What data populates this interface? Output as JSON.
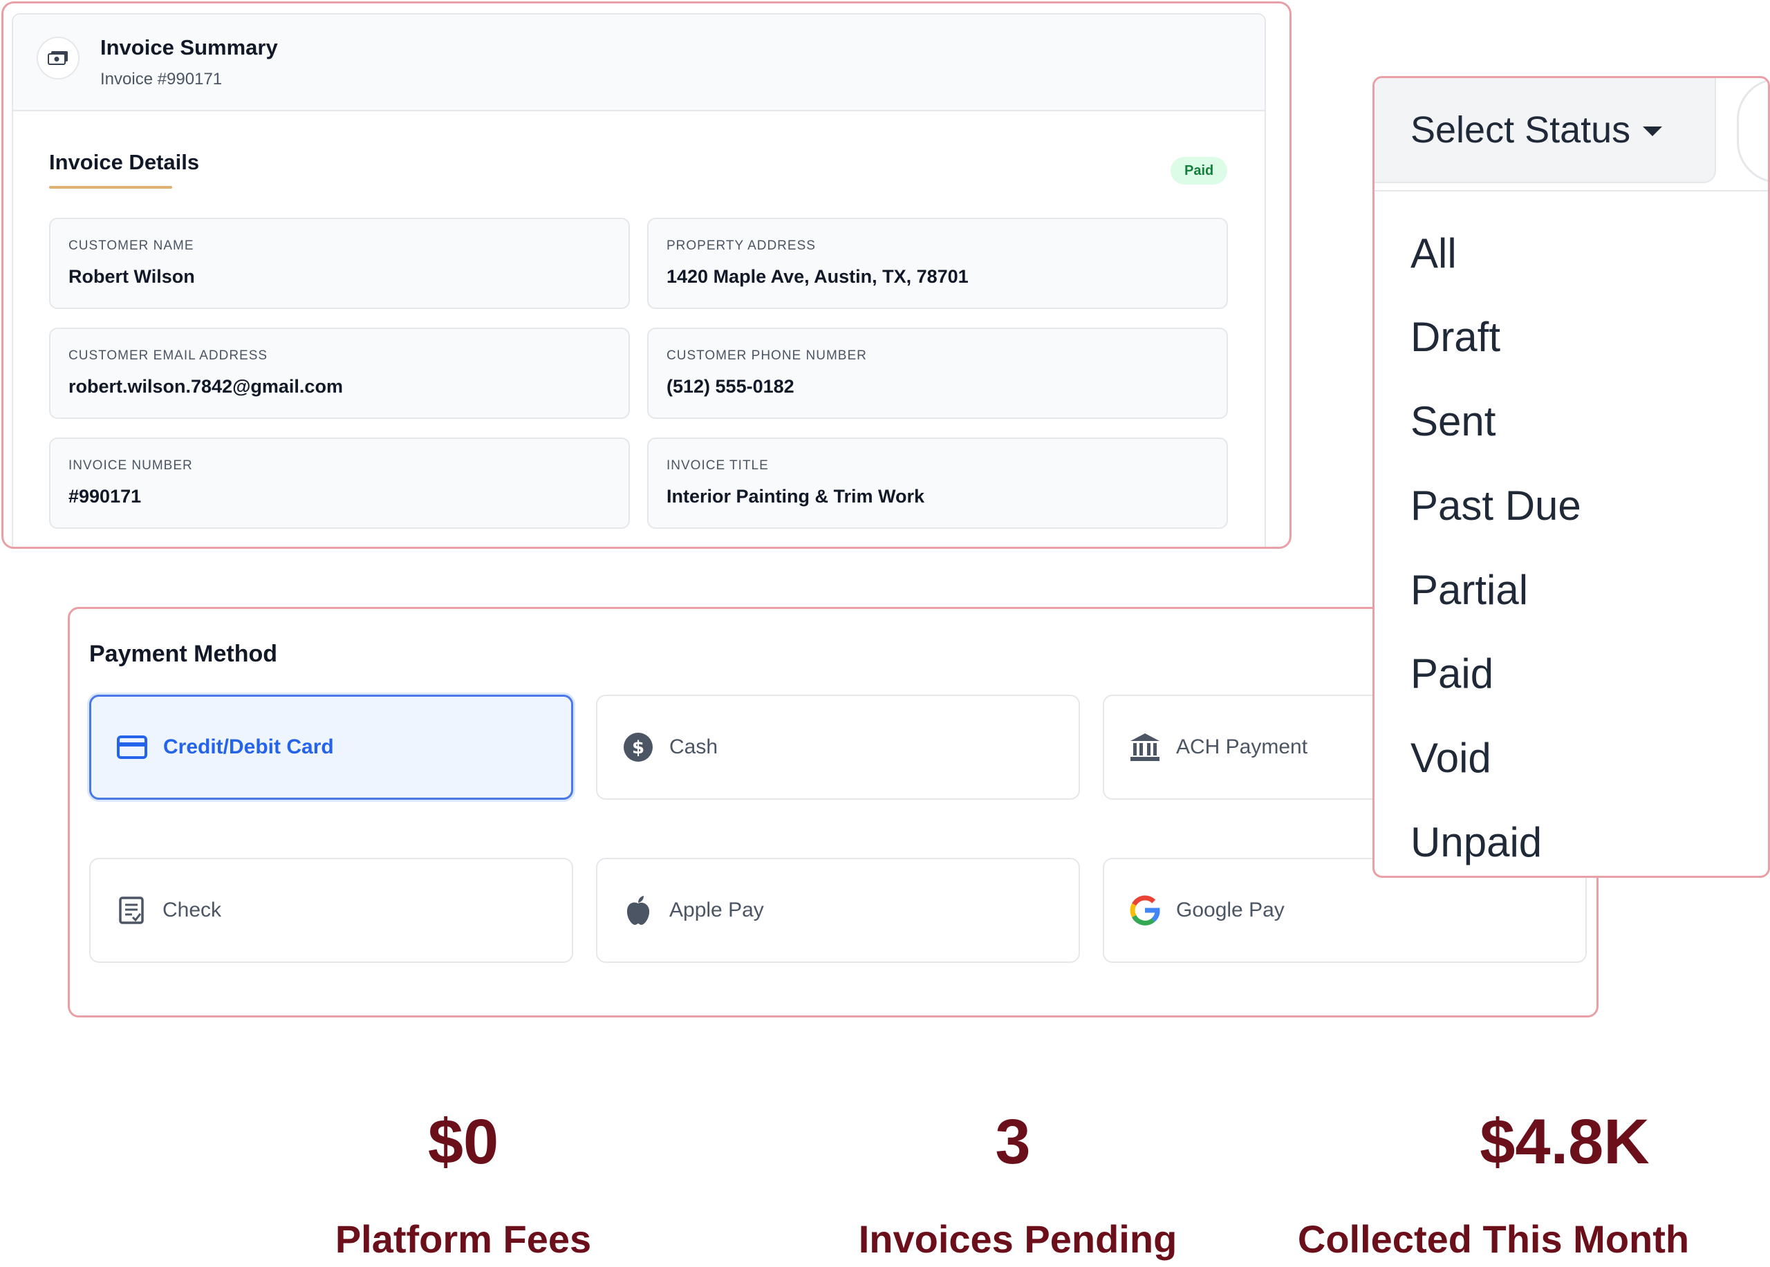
{
  "invoice": {
    "title": "Invoice Summary",
    "subtitle": "Invoice #990171",
    "details_title": "Invoice Details",
    "status_badge": "Paid",
    "fields": [
      {
        "label": "CUSTOMER NAME",
        "value": "Robert Wilson"
      },
      {
        "label": "PROPERTY ADDRESS",
        "value": "1420 Maple Ave, Austin, TX, 78701"
      },
      {
        "label": "CUSTOMER EMAIL ADDRESS",
        "value": "robert.wilson.7842@gmail.com"
      },
      {
        "label": "CUSTOMER PHONE NUMBER",
        "value": "(512) 555-0182"
      },
      {
        "label": "INVOICE NUMBER",
        "value": "#990171"
      },
      {
        "label": "INVOICE TITLE",
        "value": "Interior Painting & Trim Work"
      }
    ]
  },
  "payment": {
    "title": "Payment Method",
    "methods": [
      {
        "label": "Credit/Debit Card",
        "icon": "credit-card-icon",
        "selected": true
      },
      {
        "label": "Cash",
        "icon": "dollar-circle-icon",
        "selected": false
      },
      {
        "label": "ACH Payment",
        "icon": "bank-icon",
        "selected": false
      },
      {
        "label": "Check",
        "icon": "check-document-icon",
        "selected": false
      },
      {
        "label": "Apple Pay",
        "icon": "apple-icon",
        "selected": false
      },
      {
        "label": "Google Pay",
        "icon": "google-icon",
        "selected": false
      }
    ]
  },
  "status_dropdown": {
    "button_label": "Select Status",
    "options": [
      "All",
      "Draft",
      "Sent",
      "Past Due",
      "Partial",
      "Paid",
      "Void",
      "Unpaid"
    ]
  },
  "stats": [
    {
      "value": "$0",
      "label": "Platform Fees"
    },
    {
      "value": "3",
      "label": "Invoices Pending"
    },
    {
      "value": "$4.8K",
      "label": "Collected This Month"
    }
  ],
  "colors": {
    "accent_blue": "#2563eb",
    "stat_maroon": "#6b0f1a",
    "panel_border": "#e8a0a6",
    "paid_green": "#15803d"
  }
}
